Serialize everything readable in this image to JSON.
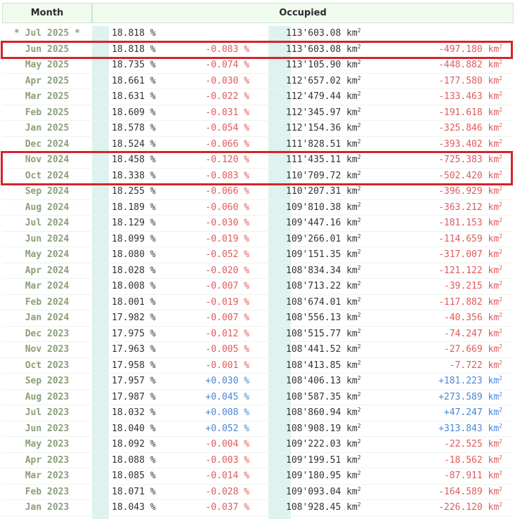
{
  "header": {
    "month": "Month",
    "occupied": "Occupied"
  },
  "rows": [
    {
      "month": "* Jul 2025 *",
      "pct": "18.818 %",
      "pct_delta": "",
      "area": "113'603.08 km",
      "area_delta": ""
    },
    {
      "month": "Jun 2025",
      "pct": "18.818 %",
      "pct_delta": "-0.083 %",
      "area": "113'603.08 km",
      "area_delta": "-497.180 km"
    },
    {
      "month": "May 2025",
      "pct": "18.735 %",
      "pct_delta": "-0.074 %",
      "area": "113'105.90 km",
      "area_delta": "-448.882 km"
    },
    {
      "month": "Apr 2025",
      "pct": "18.661 %",
      "pct_delta": "-0.030 %",
      "area": "112'657.02 km",
      "area_delta": "-177.580 km"
    },
    {
      "month": "Mar 2025",
      "pct": "18.631 %",
      "pct_delta": "-0.022 %",
      "area": "112'479.44 km",
      "area_delta": "-133.463 km"
    },
    {
      "month": "Feb 2025",
      "pct": "18.609 %",
      "pct_delta": "-0.031 %",
      "area": "112'345.97 km",
      "area_delta": "-191.618 km"
    },
    {
      "month": "Jan 2025",
      "pct": "18.578 %",
      "pct_delta": "-0.054 %",
      "area": "112'154.36 km",
      "area_delta": "-325.846 km"
    },
    {
      "month": "Dec 2024",
      "pct": "18.524 %",
      "pct_delta": "-0.066 %",
      "area": "111'828.51 km",
      "area_delta": "-393.402 km"
    },
    {
      "month": "Nov 2024",
      "pct": "18.458 %",
      "pct_delta": "-0.120 %",
      "area": "111'435.11 km",
      "area_delta": "-725.383 km"
    },
    {
      "month": "Oct 2024",
      "pct": "18.338 %",
      "pct_delta": "-0.083 %",
      "area": "110'709.72 km",
      "area_delta": "-502.420 km"
    },
    {
      "month": "Sep 2024",
      "pct": "18.255 %",
      "pct_delta": "-0.066 %",
      "area": "110'207.31 km",
      "area_delta": "-396.929 km"
    },
    {
      "month": "Aug 2024",
      "pct": "18.189 %",
      "pct_delta": "-0.060 %",
      "area": "109'810.38 km",
      "area_delta": "-363.212 km"
    },
    {
      "month": "Jul 2024",
      "pct": "18.129 %",
      "pct_delta": "-0.030 %",
      "area": "109'447.16 km",
      "area_delta": "-181.153 km"
    },
    {
      "month": "Jun 2024",
      "pct": "18.099 %",
      "pct_delta": "-0.019 %",
      "area": "109'266.01 km",
      "area_delta": "-114.659 km"
    },
    {
      "month": "May 2024",
      "pct": "18.080 %",
      "pct_delta": "-0.052 %",
      "area": "109'151.35 km",
      "area_delta": "-317.007 km"
    },
    {
      "month": "Apr 2024",
      "pct": "18.028 %",
      "pct_delta": "-0.020 %",
      "area": "108'834.34 km",
      "area_delta": "-121.122 km"
    },
    {
      "month": "Mar 2024",
      "pct": "18.008 %",
      "pct_delta": "-0.007 %",
      "area": "108'713.22 km",
      "area_delta": "-39.215 km"
    },
    {
      "month": "Feb 2024",
      "pct": "18.001 %",
      "pct_delta": "-0.019 %",
      "area": "108'674.01 km",
      "area_delta": "-117.882 km"
    },
    {
      "month": "Jan 2024",
      "pct": "17.982 %",
      "pct_delta": "-0.007 %",
      "area": "108'556.13 km",
      "area_delta": "-40.356 km"
    },
    {
      "month": "Dec 2023",
      "pct": "17.975 %",
      "pct_delta": "-0.012 %",
      "area": "108'515.77 km",
      "area_delta": "-74.247 km"
    },
    {
      "month": "Nov 2023",
      "pct": "17.963 %",
      "pct_delta": "-0.005 %",
      "area": "108'441.52 km",
      "area_delta": "-27.669 km"
    },
    {
      "month": "Oct 2023",
      "pct": "17.958 %",
      "pct_delta": "-0.001 %",
      "area": "108'413.85 km",
      "area_delta": "-7.722 km"
    },
    {
      "month": "Sep 2023",
      "pct": "17.957 %",
      "pct_delta": "+0.030 %",
      "area": "108'406.13 km",
      "area_delta": "+181.223 km"
    },
    {
      "month": "Aug 2023",
      "pct": "17.987 %",
      "pct_delta": "+0.045 %",
      "area": "108'587.35 km",
      "area_delta": "+273.589 km"
    },
    {
      "month": "Jul 2023",
      "pct": "18.032 %",
      "pct_delta": "+0.008 %",
      "area": "108'860.94 km",
      "area_delta": "+47.247 km"
    },
    {
      "month": "Jun 2023",
      "pct": "18.040 %",
      "pct_delta": "+0.052 %",
      "area": "108'908.19 km",
      "area_delta": "+313.843 km"
    },
    {
      "month": "May 2023",
      "pct": "18.092 %",
      "pct_delta": "-0.004 %",
      "area": "109'222.03 km",
      "area_delta": "-22.525 km"
    },
    {
      "month": "Apr 2023",
      "pct": "18.088 %",
      "pct_delta": "-0.003 %",
      "area": "109'199.51 km",
      "area_delta": "-18.562 km"
    },
    {
      "month": "Mar 2023",
      "pct": "18.085 %",
      "pct_delta": "-0.014 %",
      "area": "109'180.95 km",
      "area_delta": "-87.911 km"
    },
    {
      "month": "Feb 2023",
      "pct": "18.071 %",
      "pct_delta": "-0.028 %",
      "area": "109'093.04 km",
      "area_delta": "-164.589 km"
    },
    {
      "month": "Jan 2023",
      "pct": "18.043 %",
      "pct_delta": "-0.037 %",
      "area": "108'928.45 km",
      "area_delta": "-226.120 km"
    }
  ],
  "area_unit_superscript": "2",
  "highlighted_rows": [
    "Jun 2025",
    "Nov 2024",
    "Oct 2024"
  ],
  "colors": {
    "negative": "#e05a5a",
    "positive": "#4a86d8",
    "highlight": "#d5232b",
    "header_bg": "#f0fbee",
    "month_text": "#8aa07a"
  }
}
